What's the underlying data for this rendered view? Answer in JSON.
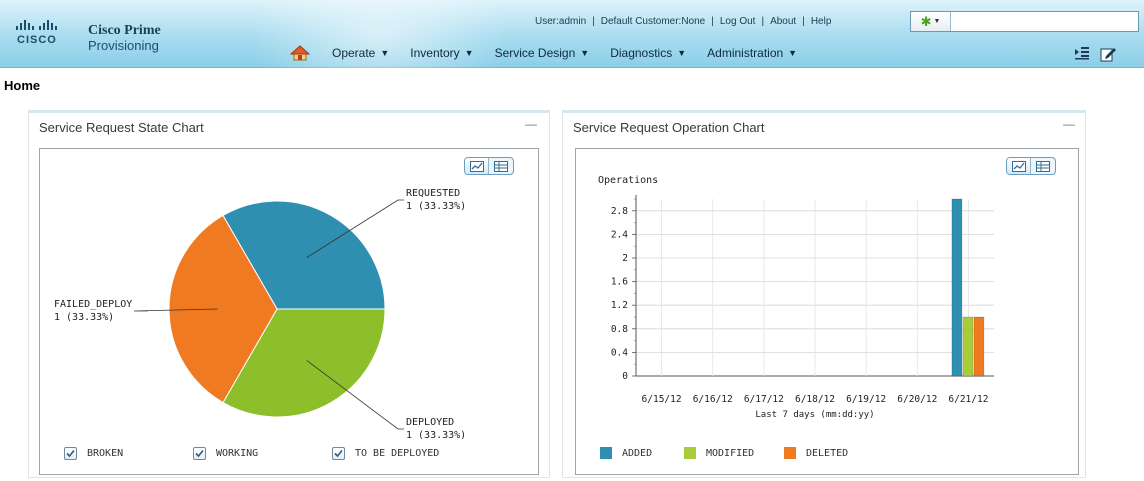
{
  "brand": {
    "logo_word": "CISCO",
    "product_line1": "Cisco Prime",
    "product_line2": "Provisioning"
  },
  "utility": {
    "user": "User:admin",
    "customer": "Default Customer:None",
    "logout": "Log Out",
    "about": "About",
    "help": "Help",
    "separator": "|"
  },
  "search": {
    "value": "",
    "placeholder": ""
  },
  "nav": {
    "items": [
      {
        "label": "Operate"
      },
      {
        "label": "Inventory"
      },
      {
        "label": "Service Design"
      },
      {
        "label": "Diagnostics"
      },
      {
        "label": "Administration"
      }
    ]
  },
  "page": {
    "title": "Home"
  },
  "state_panel": {
    "title": "Service Request State Chart",
    "checkboxes": [
      {
        "label": "BROKEN",
        "checked": true
      },
      {
        "label": "WORKING",
        "checked": true
      },
      {
        "label": "TO BE DEPLOYED",
        "checked": true
      }
    ]
  },
  "operation_panel": {
    "title": "Service Request Operation Chart"
  },
  "colors": {
    "requested": "#2f8fb0",
    "deployed": "#8dbf2a",
    "failed": "#f07a22",
    "added": "#2f8fb0",
    "modified": "#a9cc3b",
    "deleted": "#f07a22"
  },
  "chart_data": [
    {
      "type": "pie",
      "slices": [
        {
          "name": "REQUESTED",
          "value": 1,
          "label": "1 (33.33%)"
        },
        {
          "name": "DEPLOYED",
          "value": 1,
          "label": "1 (33.33%)"
        },
        {
          "name": "FAILED_DEPLOY",
          "value": 1,
          "label": "1 (33.33%)"
        }
      ]
    },
    {
      "type": "bar",
      "ylabel": "Operations",
      "xlabel": "Last 7 days (mm:dd:yy)",
      "ylim": [
        0,
        3.0
      ],
      "yticks": [
        0,
        0.4,
        0.8,
        1.2,
        1.6,
        2,
        2.4,
        2.8
      ],
      "categories": [
        "6/15/12",
        "6/16/12",
        "6/17/12",
        "6/18/12",
        "6/19/12",
        "6/20/12",
        "6/21/12"
      ],
      "series": [
        {
          "name": "ADDED",
          "values": [
            0,
            0,
            0,
            0,
            0,
            0,
            3
          ]
        },
        {
          "name": "MODIFIED",
          "values": [
            0,
            0,
            0,
            0,
            0,
            0,
            1
          ]
        },
        {
          "name": "DELETED",
          "values": [
            0,
            0,
            0,
            0,
            0,
            0,
            1
          ]
        }
      ]
    }
  ]
}
